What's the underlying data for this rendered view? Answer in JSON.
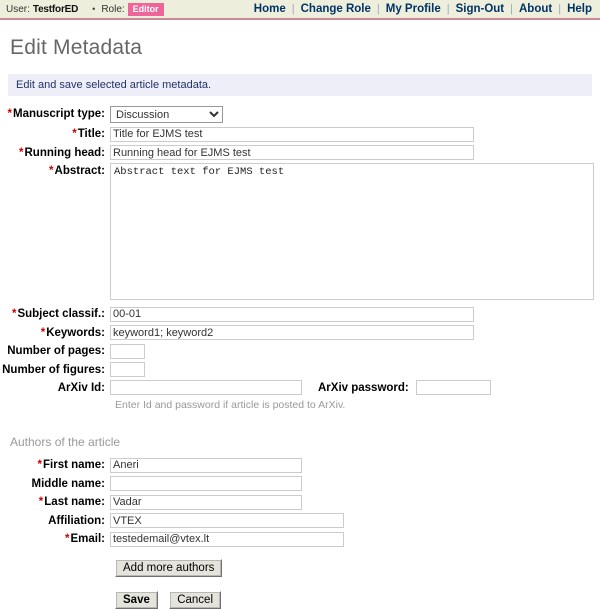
{
  "topbar": {
    "user_label": "User:",
    "user_name": "TestforED",
    "bullet": "•",
    "role_label": "Role:",
    "role_value": "Editor",
    "role_badge_color": "#ee6699",
    "nav": [
      {
        "label": "Home"
      },
      {
        "label": "Change Role"
      },
      {
        "label": "My Profile"
      },
      {
        "label": "Sign-Out"
      },
      {
        "label": "About"
      },
      {
        "label": "Help"
      }
    ],
    "nav_separator": "|"
  },
  "page": {
    "title": "Edit Metadata",
    "info_message": "Edit and save selected article metadata.",
    "info_bg": "#eeeef9",
    "required_marker": "*"
  },
  "form": {
    "manuscript_type": {
      "label": "Manuscript type:",
      "required": true,
      "value": "Discussion",
      "options": [
        "Discussion"
      ]
    },
    "title": {
      "label": "Title:",
      "required": true,
      "value": "Title for EJMS test"
    },
    "running_head": {
      "label": "Running head:",
      "required": true,
      "value": "Running head for EJMS test"
    },
    "abstract": {
      "label": "Abstract:",
      "required": true,
      "value": "Abstract text for EJMS test"
    },
    "subject_classif": {
      "label": "Subject classif.:",
      "required": true,
      "value": "00-01"
    },
    "keywords": {
      "label": "Keywords:",
      "required": true,
      "value": "keyword1; keyword2"
    },
    "number_of_pages": {
      "label": "Number of pages:",
      "required": false,
      "value": ""
    },
    "number_of_figures": {
      "label": "Number of figures:",
      "required": false,
      "value": ""
    },
    "arxiv_id": {
      "label": "ArXiv Id:",
      "required": false,
      "value": ""
    },
    "arxiv_password": {
      "label": "ArXiv password:",
      "required": false,
      "value": ""
    },
    "arxiv_hint": "Enter Id and password if article is posted to ArXiv."
  },
  "authors": {
    "section_title": "Authors of the article",
    "first_name": {
      "label": "First name:",
      "required": true,
      "value": "Aneri"
    },
    "middle_name": {
      "label": "Middle name:",
      "required": false,
      "value": ""
    },
    "last_name": {
      "label": "Last name:",
      "required": true,
      "value": "Vadar"
    },
    "affiliation": {
      "label": "Affiliation:",
      "required": false,
      "value": "VTEX"
    },
    "email": {
      "label": "Email:",
      "required": true,
      "value": "testedemail@vtex.lt"
    },
    "add_more_button": "Add more authors"
  },
  "actions": {
    "save": "Save",
    "cancel": "Cancel"
  }
}
